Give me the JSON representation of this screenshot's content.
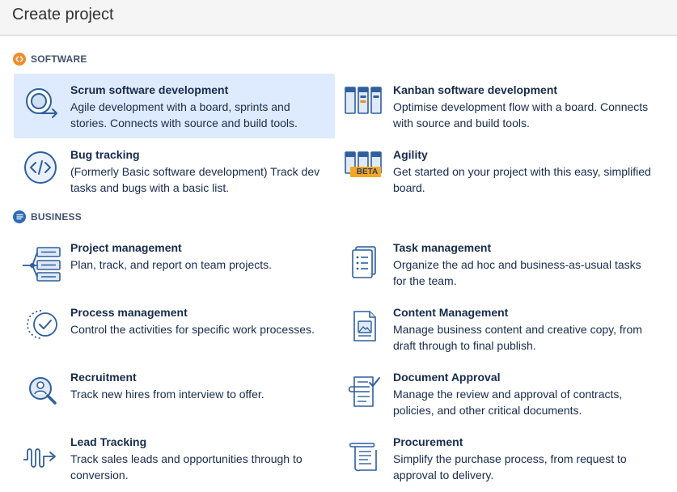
{
  "header": {
    "title": "Create project"
  },
  "sections": {
    "software": {
      "label": "SOFTWARE",
      "color": "#f08b2d",
      "items": [
        {
          "title": "Scrum software development",
          "desc": "Agile development with a board, sprints and stories. Connects with source and build tools.",
          "icon": "scrum-cycle-icon",
          "selected": true
        },
        {
          "title": "Kanban software development",
          "desc": "Optimise development flow with a board. Connects with source and build tools.",
          "icon": "kanban-board-icon"
        },
        {
          "title": "Bug tracking",
          "desc": "(Formerly Basic software development) Track dev tasks and bugs with a basic list.",
          "icon": "code-icon"
        },
        {
          "title": "Agility",
          "desc": "Get started on your project with this easy, simplified board.",
          "icon": "agility-board-icon",
          "badge": "BETA"
        }
      ]
    },
    "business": {
      "label": "BUSINESS",
      "color": "#2f6bb3",
      "items": [
        {
          "title": "Project management",
          "desc": "Plan, track, and report on team projects.",
          "icon": "project-management-icon"
        },
        {
          "title": "Task management",
          "desc": "Organize the ad hoc and business-as-usual tasks for the team.",
          "icon": "task-list-icon"
        },
        {
          "title": "Process management",
          "desc": "Control the activities for specific work processes.",
          "icon": "process-check-icon"
        },
        {
          "title": "Content Management",
          "desc": "Manage business content and creative copy, from draft through to final publish.",
          "icon": "content-document-icon"
        },
        {
          "title": "Recruitment",
          "desc": "Track new hires from interview to offer.",
          "icon": "recruitment-magnifier-icon"
        },
        {
          "title": "Document Approval",
          "desc": "Manage the review and approval of contracts, policies, and other critical documents.",
          "icon": "document-approval-icon"
        },
        {
          "title": "Lead Tracking",
          "desc": "Track sales leads and opportunities through to conversion.",
          "icon": "lead-tracking-icon"
        },
        {
          "title": "Procurement",
          "desc": "Simplify the purchase process, from request to approval to delivery.",
          "icon": "procurement-receipt-icon"
        }
      ]
    }
  }
}
